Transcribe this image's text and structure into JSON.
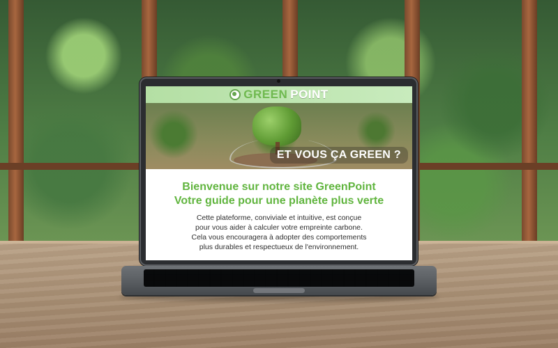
{
  "site": {
    "logo": {
      "green": "GREEN",
      "point": "POINT"
    },
    "hero": {
      "slogan": "ET VOUS ÇA GREEN ?"
    },
    "content": {
      "title_lines": [
        "Bienvenue sur notre site GreenPoint",
        "Votre guide pour une planète plus verte"
      ],
      "description_lines": [
        "Cette plateforme, conviviale et intuitive, est conçue",
        "pour vous aider à calculer votre empreinte carbone.",
        "Cela vous encouragera à adopter des comportements",
        "plus durables et respectueux de l'environnement."
      ]
    }
  },
  "colors": {
    "green_text": "#61b53f",
    "header_green": "#b4dfa4",
    "dark_text": "#2d2d2d"
  },
  "icons": {
    "logo": "leaf-circle-icon"
  }
}
